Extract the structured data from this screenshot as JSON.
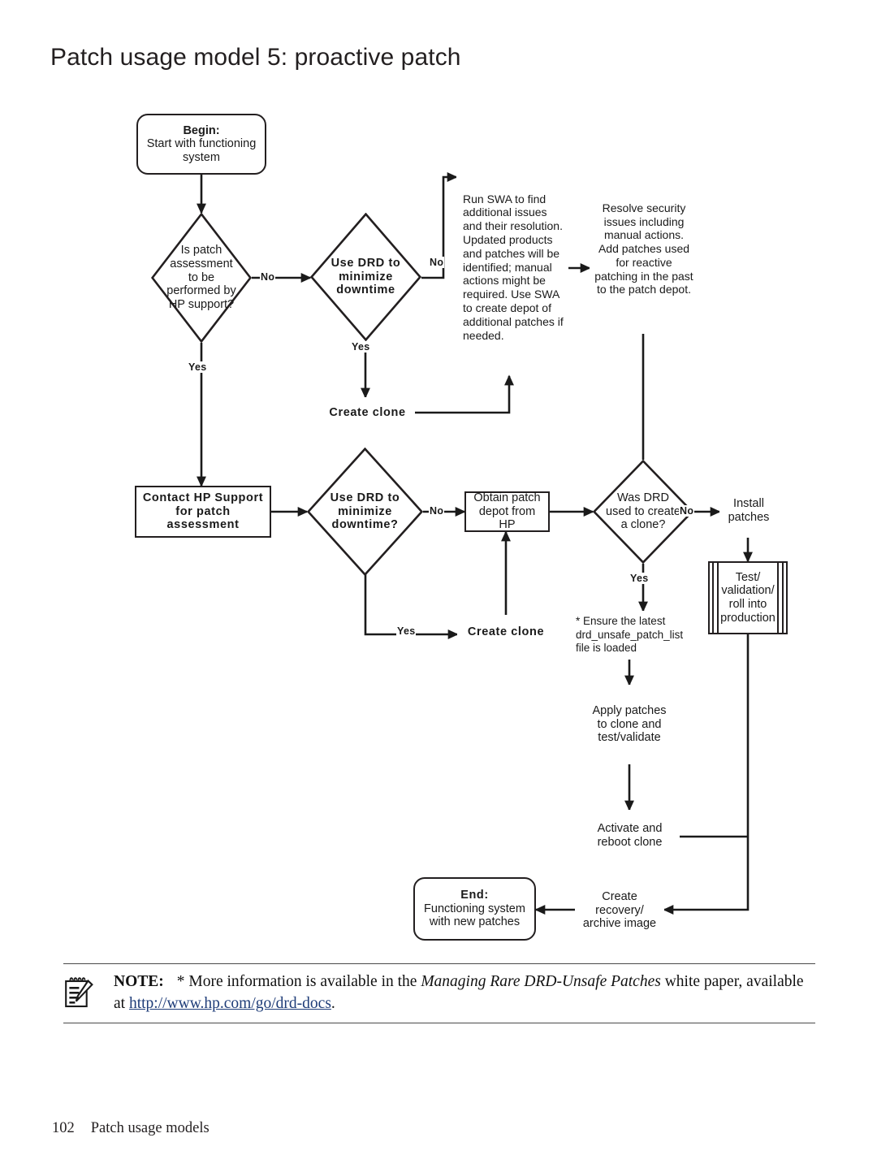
{
  "page": {
    "title": "Patch usage model 5: proactive patch",
    "footer_page_number": "102",
    "footer_section": "Patch usage models"
  },
  "colors": {
    "outline": "#231f20",
    "red": "#8e1d22",
    "pink": "#c767b0",
    "orange": "#f9a32c",
    "teal": "#11787a",
    "link": "#1e3c78"
  },
  "flowchart": {
    "type": "flowchart",
    "nodes": {
      "begin": {
        "shape": "terminator",
        "label_bold": "Begin:",
        "label": "Start with functioning system"
      },
      "assess_decision": {
        "shape": "decision",
        "label": "Is patch assessment to be performed by HP support?"
      },
      "use_drd_top": {
        "shape": "decision",
        "label": "Use DRD to minimize downtime"
      },
      "run_swa": {
        "shape": "process",
        "color": "pink",
        "label": "Run SWA to find additional issues and their resolution. Updated products and patches will be identified; manual actions might be required. Use SWA to create depot of additional patches if needed."
      },
      "resolve_security": {
        "shape": "process",
        "color": "red",
        "label": "Resolve security issues including manual actions. Add patches used for reactive patching in the past to the patch depot."
      },
      "create_clone_top": {
        "shape": "process",
        "color": "orange",
        "label": "Create clone"
      },
      "contact_hp": {
        "shape": "process",
        "label": "Contact HP Support for patch assessment"
      },
      "use_drd_mid": {
        "shape": "decision",
        "label": "Use DRD to minimize downtime?"
      },
      "obtain_depot": {
        "shape": "process",
        "label": "Obtain patch depot from HP"
      },
      "was_drd_used": {
        "shape": "decision",
        "label": "Was DRD used to create a clone?"
      },
      "install_patches": {
        "shape": "process",
        "color": "red",
        "label": "Install patches"
      },
      "test_validation": {
        "shape": "predefined-process",
        "label": "Test/ validation/ roll into production"
      },
      "create_clone_mid": {
        "shape": "process",
        "color": "orange",
        "label": "Create clone"
      },
      "ensure_latest": {
        "shape": "process",
        "color": "orange",
        "label": "* Ensure the latest drd_unsafe_patch_list file is loaded"
      },
      "apply_patches": {
        "shape": "process",
        "color": "red",
        "label": "Apply patches to clone and test/validate"
      },
      "activate_reboot": {
        "shape": "process",
        "color": "orange",
        "label": "Activate and reboot clone"
      },
      "create_recovery": {
        "shape": "process",
        "color": "teal",
        "label": "Create recovery/ archive image"
      },
      "end": {
        "shape": "terminator",
        "label_bold": "End:",
        "label": "Functioning system with new patches"
      }
    },
    "edge_labels": {
      "assess_no": "No",
      "assess_yes": "Yes",
      "drd_top_no": "No",
      "drd_top_yes": "Yes",
      "drd_mid_no": "No",
      "drd_mid_yes": "Yes",
      "was_drd_no": "No",
      "was_drd_yes": "Yes"
    }
  },
  "note": {
    "label": "NOTE:",
    "text_before": "* More information is available in the ",
    "italic_title": "Managing Rare DRD-Unsafe Patches",
    "text_after": " white paper, available at ",
    "link": "http://www.hp.com/go/drd-docs",
    "text_end": "."
  },
  "icons": {
    "note": "notepad-pencil-icon"
  }
}
